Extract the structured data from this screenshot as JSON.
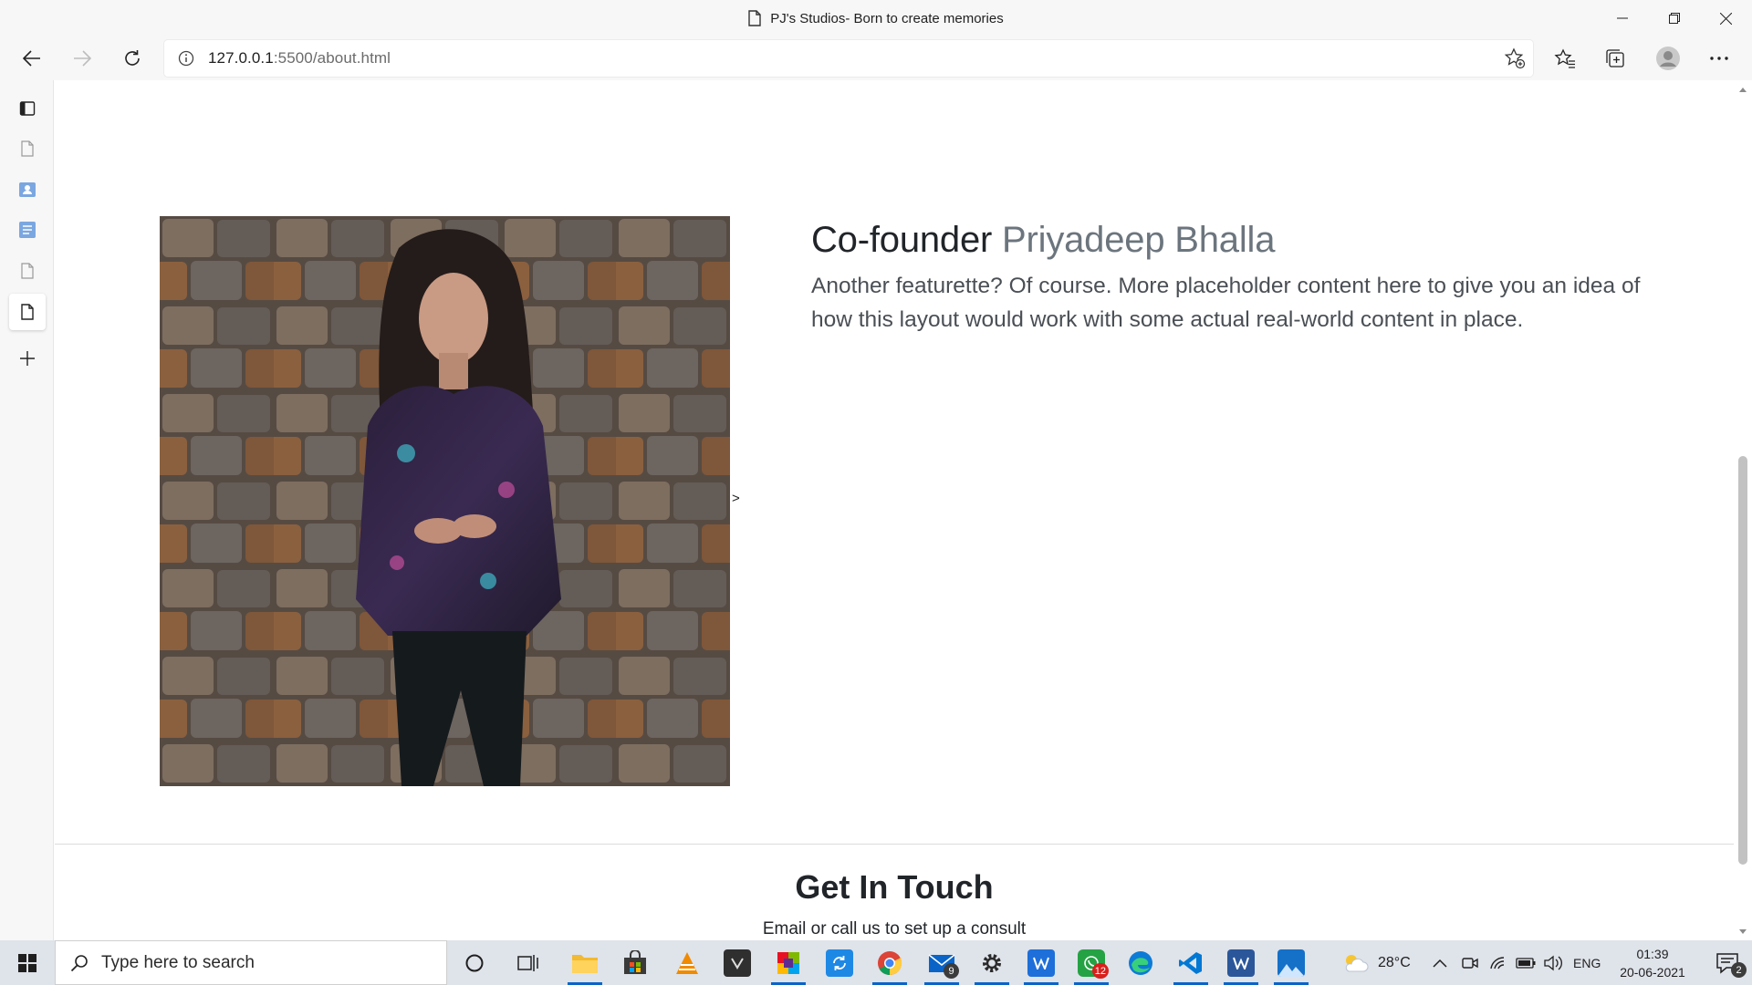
{
  "browser": {
    "window_title": "PJ's Studios- Born to create memories",
    "url_host": "127.0.0.1",
    "url_rest": ":5500/about.html"
  },
  "page": {
    "heading_prefix": "Co-founder",
    "heading_name": "Priyadeep Bhalla",
    "lead": "Another featurette? Of course. More placeholder content here to give you an idea of how this layout would work with some actual real-world content in place.",
    "carousel_arrow": ">",
    "contact_title": "Get In Touch",
    "contact_subtitle": "Email or call us to set up a consult"
  },
  "taskbar": {
    "search_placeholder": "Type here to search",
    "mail_badge": "9",
    "whatsapp_badge": "12",
    "temperature": "28°C",
    "language": "ENG",
    "time": "01:39",
    "date": "20-06-2021",
    "notification_count": "2"
  }
}
